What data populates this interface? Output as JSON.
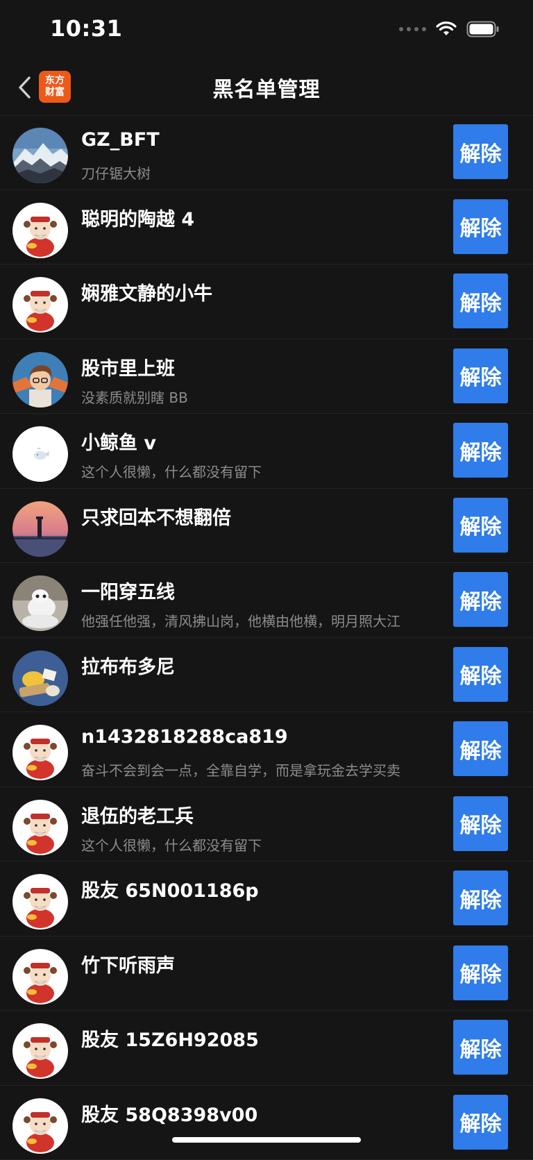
{
  "status_bar": {
    "time": "10:31",
    "icons": [
      "cellular-icon",
      "wifi-icon",
      "battery-icon"
    ]
  },
  "header": {
    "title": "黑名单管理",
    "back_icon": "chevron-left-icon",
    "logo_line1": "东方",
    "logo_line2": "财富"
  },
  "colors": {
    "background": "#151515",
    "button": "#2f7cea",
    "logo": "#ec5a1a",
    "secondary_text": "#8c8c8c"
  },
  "blocked_users": [
    {
      "name": "GZ_BFT",
      "bio": "刀仔锯大树",
      "avatar": "mountain-photo",
      "action": "解除"
    },
    {
      "name": "聪明的陶越 4",
      "bio": "",
      "avatar": "default-mascot",
      "action": "解除"
    },
    {
      "name": "娴雅文静的小牛",
      "bio": "",
      "avatar": "default-mascot",
      "action": "解除"
    },
    {
      "name": "股市里上班",
      "bio": "没素质就别瞎 BB",
      "avatar": "cartoon-boy",
      "action": "解除"
    },
    {
      "name": "小鲸鱼 v",
      "bio": "这个人很懒，什么都没有留下",
      "avatar": "whale",
      "action": "解除"
    },
    {
      "name": "只求回本不想翻倍",
      "bio": "",
      "avatar": "sunset-lighthouse",
      "action": "解除"
    },
    {
      "name": "一阳穿五线",
      "bio": "他强任他强，清风拂山岗，他横由他横，明月照大江",
      "avatar": "white-robot",
      "action": "解除"
    },
    {
      "name": "拉布布多尼",
      "bio": "",
      "avatar": "food-photo",
      "action": "解除"
    },
    {
      "name": "n1432818288ca819",
      "bio": "奋斗不会到会一点，全靠自学，而是拿玩金去学买卖",
      "avatar": "default-mascot",
      "action": "解除"
    },
    {
      "name": "退伍的老工兵",
      "bio": "这个人很懒，什么都没有留下",
      "avatar": "default-mascot",
      "action": "解除"
    },
    {
      "name": "股友 65N001186p",
      "bio": "",
      "avatar": "default-mascot",
      "action": "解除"
    },
    {
      "name": "竹下听雨声",
      "bio": "",
      "avatar": "default-mascot",
      "action": "解除"
    },
    {
      "name": "股友 15Z6H92085",
      "bio": "",
      "avatar": "default-mascot",
      "action": "解除"
    },
    {
      "name": "股友 58Q8398v00",
      "bio": "",
      "avatar": "default-mascot",
      "action": "解除"
    }
  ]
}
